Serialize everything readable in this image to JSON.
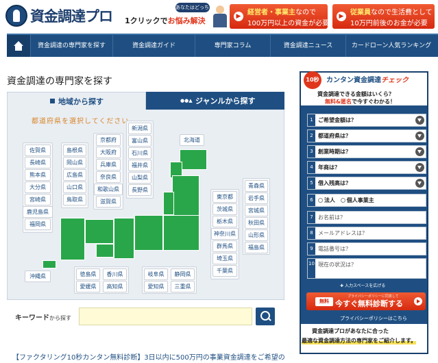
{
  "header": {
    "logo_text": "資金調達プロ",
    "bubble": "あなたはどっち？",
    "tagline_prefix": "1クリックで",
    "tagline_red": "お悩み解決",
    "cta1": {
      "highlight": "経営者・事業主",
      "line1_rest": "なので",
      "line2": "100万円以上の資金が必要"
    },
    "cta2": {
      "highlight": "従業員",
      "line1_rest": "なので生活費として",
      "line2": "10万円前後のお金が必要"
    },
    "accent": "#1f4f82",
    "cta_color": "#e0361c"
  },
  "nav": {
    "home_icon": "home-icon",
    "items": [
      "資金調達の専門家を探す",
      "資金調達ガイド",
      "専門家コラム",
      "資金調達ニュース",
      "カードローン人気ランキング"
    ]
  },
  "main": {
    "title": "資金調達の専門家を探す",
    "tabs": [
      "地域から探す",
      "ジャンルから探す"
    ],
    "prompt": "都道府県を選択してください",
    "prefectures": {
      "kyushu": [
        "佐賀県",
        "長崎県",
        "熊本県",
        "大分県",
        "宮崎県",
        "鹿児島県",
        "福岡県"
      ],
      "chugoku": [
        "島根県",
        "岡山県",
        "広島県",
        "山口県",
        "鳥取県"
      ],
      "kansai": [
        "京都府",
        "大阪府",
        "兵庫県",
        "奈良県",
        "和歌山県",
        "滋賀県"
      ],
      "chubu": [
        "新潟県",
        "富山県",
        "石川県",
        "福井県",
        "山梨県",
        "長野県"
      ],
      "hokkaido": [
        "北海道"
      ],
      "kanto": [
        "東京都",
        "茨城県",
        "栃木県",
        "神奈川県",
        "群馬県",
        "埼玉県",
        "千葉県"
      ],
      "tohoku": [
        "青森県",
        "岩手県",
        "宮城県",
        "秋田県",
        "山形県",
        "福島県"
      ],
      "okinawa": [
        "沖縄県"
      ],
      "shikoku": [
        "徳島県",
        "香川県",
        "愛媛県",
        "高知県"
      ],
      "tokai": [
        "岐阜県",
        "静岡県",
        "愛知県",
        "三重県"
      ]
    },
    "keyword_label": "キーワード",
    "keyword_small": "から探す",
    "keyword_value": "",
    "footer_link": "【ファクタリング10秒カンタン無料診断】3日以内に500万円の事業資金調達をご希望の"
  },
  "sidebar": {
    "badge": "10秒",
    "title_main": "カンタン資金調達",
    "title_check": "チェック",
    "sub1": "資金調達できる金額はいくら？",
    "sub2_red": "無料&匿名",
    "sub2_rest": "で今すぐわかる！",
    "steps": [
      {
        "num": "1",
        "label": "ご希望金額は？"
      },
      {
        "num": "2",
        "label": "都道府県は？"
      },
      {
        "num": "3",
        "label": "創業時期は？"
      },
      {
        "num": "4",
        "label": "年商は？"
      },
      {
        "num": "5",
        "label": "借入残高は？"
      }
    ],
    "step6": {
      "num": "6",
      "opt1": "法人",
      "opt2": "個人事業主"
    },
    "fields": [
      {
        "num": "7",
        "placeholder": "お名前は？"
      },
      {
        "num": "8",
        "placeholder": "メールアドレスは？"
      },
      {
        "num": "9",
        "placeholder": "電話番号は？"
      },
      {
        "num": "10",
        "placeholder": "現在の状況は？"
      }
    ],
    "expand": "入力スペースを広げる",
    "submit_small": "プライバシーポリシーに同意して",
    "submit_pill": "無料",
    "submit_big": "今すぐ無料診断する",
    "privacy": "プライバシーポリシーはこちら",
    "foot1": "資金調達プロがあなたに合った",
    "foot2": "最適な資金調達方法の専門家をご紹介します。"
  }
}
